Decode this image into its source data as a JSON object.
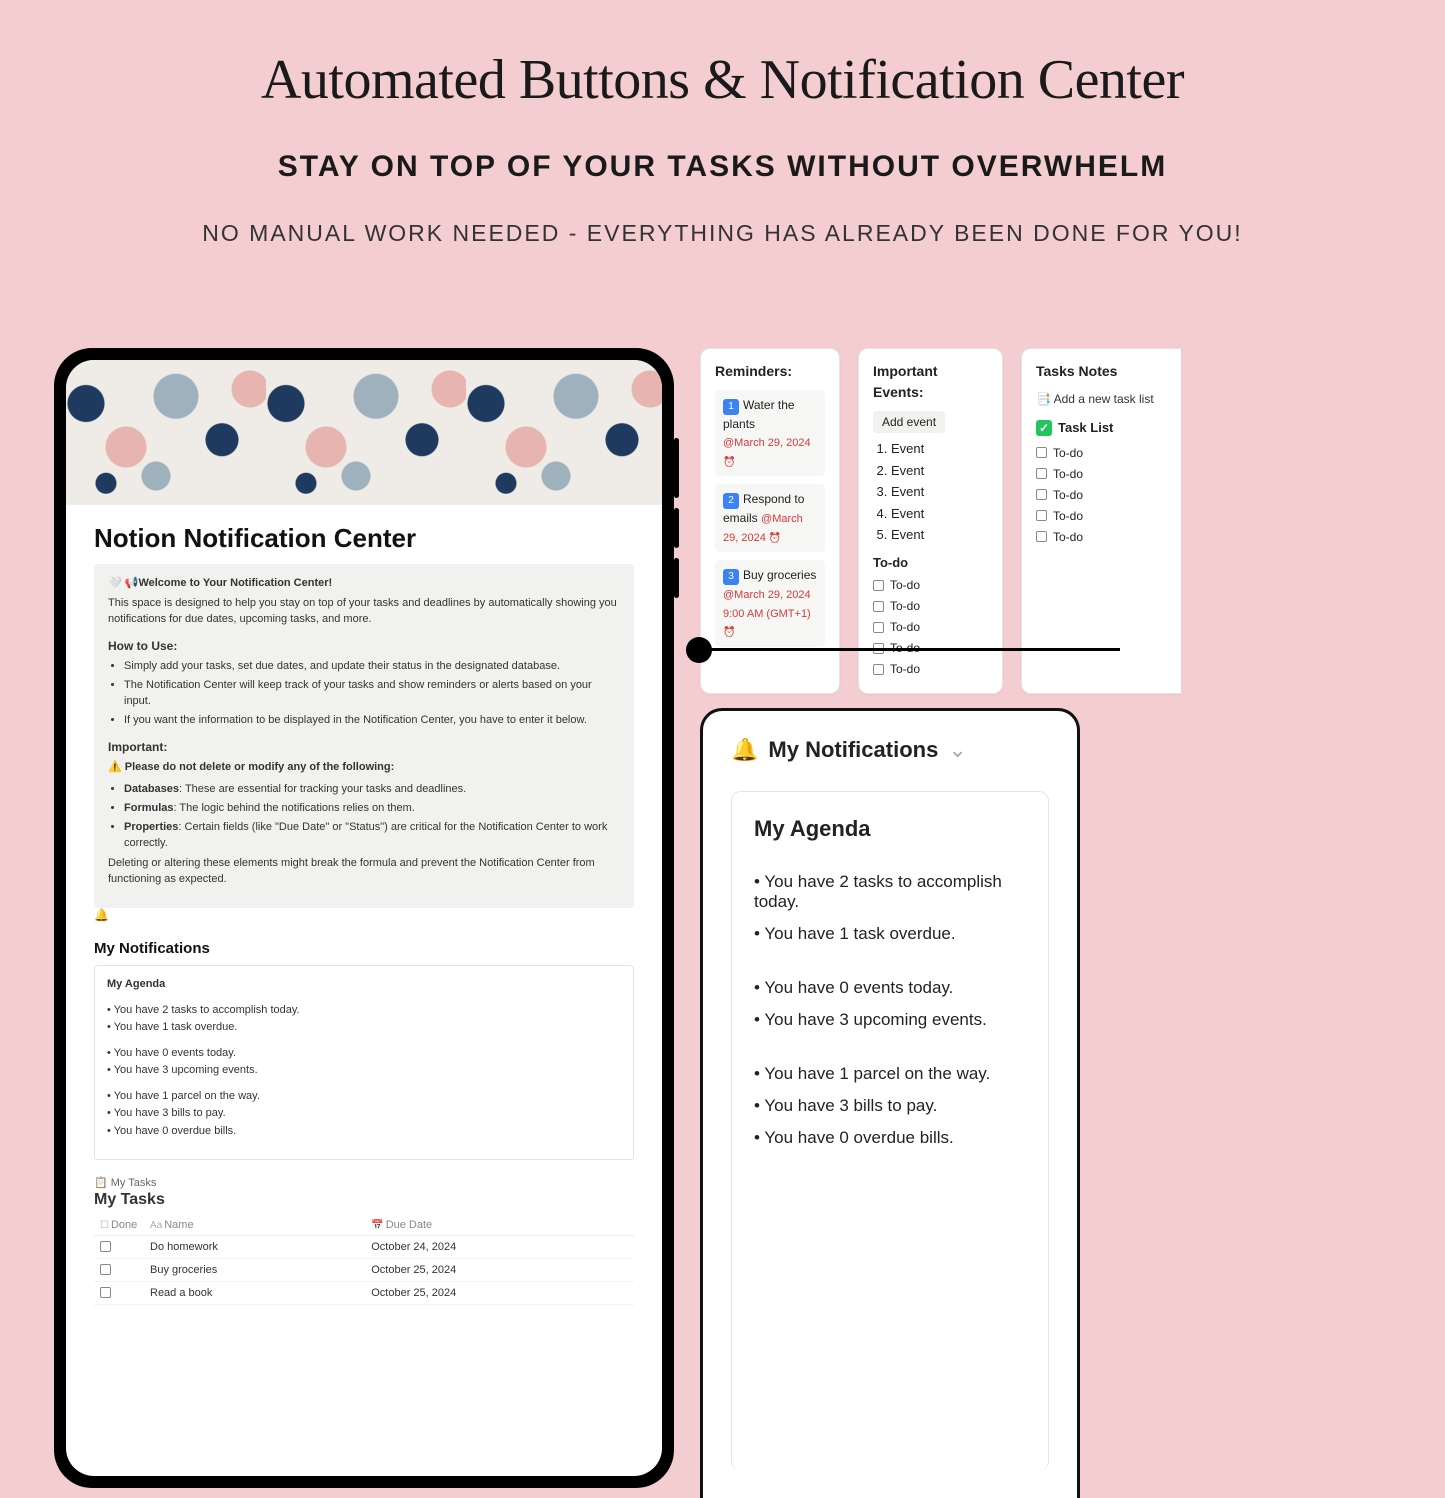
{
  "hero": {
    "title": "Automated Buttons & Notification Center",
    "subtitle": "STAY ON TOP OF YOUR TASKS WITHOUT OVERWHELM",
    "subtitle2": "NO MANUAL WORK NEEDED - EVERYTHING HAS ALREADY BEEN DONE FOR YOU!"
  },
  "page": {
    "title": "Notion Notification Center",
    "welcome_label": "🤍 📢Welcome to Your Notification Center!",
    "welcome_body": "This space is designed to help you stay on top of your tasks and deadlines by automatically showing you notifications for due dates, upcoming tasks, and more.",
    "howto_heading": "How to Use:",
    "howto": [
      "Simply add your tasks, set due dates, and update their status in the designated database.",
      "The Notification Center will keep track of your tasks and show reminders or alerts based on your input.",
      "If you want the information to be displayed in the Notification Center, you have to enter it below."
    ],
    "important_heading": "Important:",
    "important_warn": "Please do not delete or modify any of the following:",
    "important_items": [
      {
        "b": "Databases",
        "t": ": These are essential for tracking your tasks and deadlines."
      },
      {
        "b": "Formulas",
        "t": ": The logic behind the notifications relies on them."
      },
      {
        "b": "Properties",
        "t": ": Certain fields (like \"Due Date\" or \"Status\") are critical for the Notification Center to work correctly."
      }
    ],
    "important_footer": "Deleting or altering these elements might break the formula and prevent the Notification Center from functioning as expected."
  },
  "my_notifications": {
    "heading": "My Notifications",
    "agenda_title": "My Agenda",
    "g1": [
      "You have 2 tasks to accomplish today.",
      "You have 1 task overdue."
    ],
    "g2": [
      "You have 0 events today.",
      "You have 3 upcoming events."
    ],
    "g3": [
      "You have 1 parcel on the way.",
      "You have 3 bills to pay.",
      "You have 0 overdue bills."
    ]
  },
  "my_tasks": {
    "db_label": "📋 My Tasks",
    "title": "My Tasks",
    "cols": {
      "done": "Done",
      "name": "Name",
      "due": "Due Date"
    },
    "rows": [
      {
        "name": "Do homework",
        "due": "October 24, 2024"
      },
      {
        "name": "Buy groceries",
        "due": "October 25, 2024"
      },
      {
        "name": "Read a book",
        "due": "October 25, 2024"
      }
    ]
  },
  "reminders": {
    "heading": "Reminders:",
    "items": [
      {
        "num": "1",
        "title": "Water the plants",
        "date": "@March 29, 2024"
      },
      {
        "num": "2",
        "title": "Respond to emails",
        "date": "@March 29, 2024"
      },
      {
        "num": "3",
        "title": "Buy groceries",
        "date": "@March 29, 2024 9:00 AM (GMT+1)"
      }
    ]
  },
  "events": {
    "heading": "Important Events:",
    "add_label": "Add event",
    "list": [
      "Event",
      "Event",
      "Event",
      "Event",
      "Event"
    ],
    "todo_heading": "To-do",
    "todos": [
      "To-do",
      "To-do",
      "To-do",
      "To-do",
      "To-do"
    ]
  },
  "notes": {
    "heading": "Tasks Notes",
    "add_label": "Add a new task list",
    "tasklist_label": "Task List",
    "todos": [
      "To-do",
      "To-do",
      "To-do",
      "To-do",
      "To-do"
    ]
  },
  "big": {
    "heading": "My Notifications",
    "agenda": "My Agenda",
    "g1": [
      "You have 2 tasks to accomplish today.",
      "You have 1 task overdue."
    ],
    "g2": [
      "You have 0 events today.",
      "You have 3 upcoming events."
    ],
    "g3": [
      "You have 1 parcel on the way.",
      "You have 3 bills to pay.",
      "You have 0 overdue bills."
    ]
  }
}
